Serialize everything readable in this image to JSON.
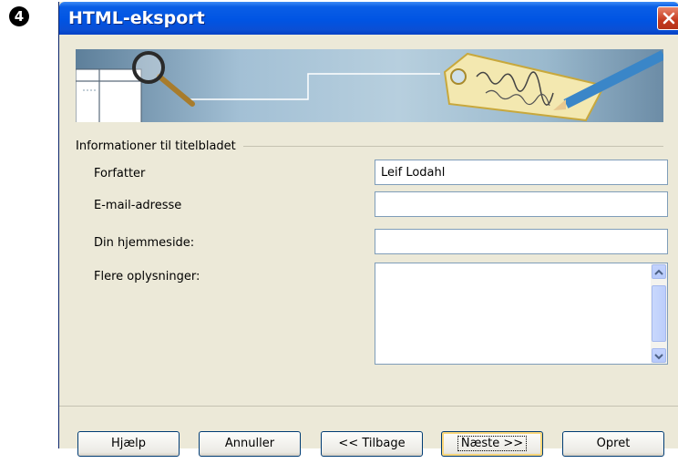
{
  "step_badge": "4",
  "window": {
    "title": "HTML-eksport"
  },
  "section": {
    "title": "Informationer til titelbladet"
  },
  "fields": {
    "author": {
      "label": "Forfatter",
      "value": "Leif Lodahl"
    },
    "email": {
      "label": "E-mail-adresse",
      "value": ""
    },
    "homepage": {
      "label": "Din hjemmeside:",
      "value": ""
    },
    "info": {
      "label": "Flere oplysninger:",
      "value": ""
    }
  },
  "buttons": {
    "help": "Hjælp",
    "cancel": "Annuller",
    "back": "<< Tilbage",
    "next": "Næste >>",
    "create": "Opret"
  },
  "colors": {
    "titlebar": "#0054e3",
    "dialog_bg": "#ece9d8",
    "close": "#c4391e"
  },
  "icons": [
    "close-icon",
    "magnifier-icon",
    "tag-icon",
    "pencil-icon",
    "scroll-up-icon",
    "scroll-down-icon"
  ]
}
